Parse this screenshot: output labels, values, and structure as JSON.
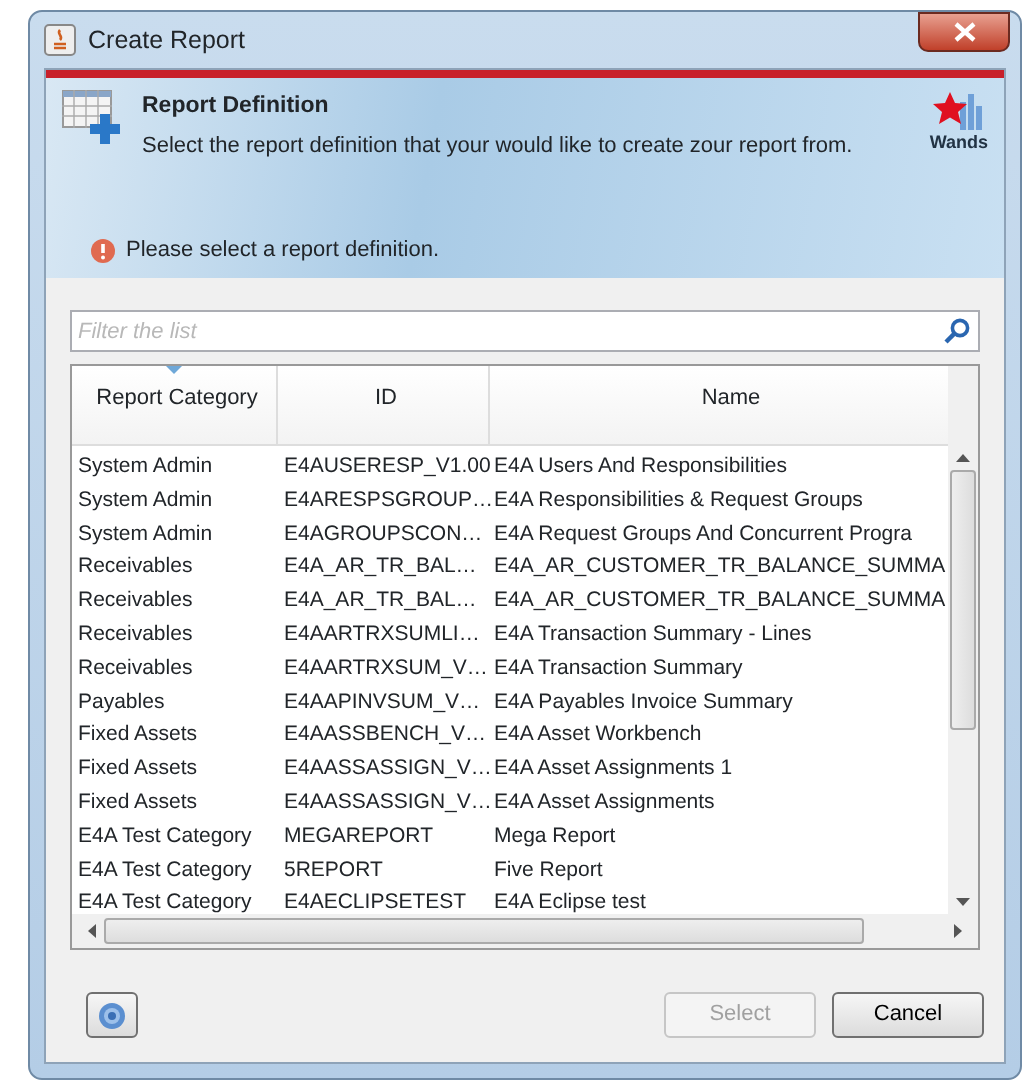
{
  "window": {
    "title": "Create Report"
  },
  "header": {
    "title": "Report Definition",
    "description": "Select the report definition that your would like to create zour report from.",
    "logo_text": "Wands",
    "message": "Please select a report definition."
  },
  "filter": {
    "placeholder": "Filter the list"
  },
  "table": {
    "columns": [
      {
        "label": "Report Category",
        "sorted": true
      },
      {
        "label": "ID",
        "sorted": false
      },
      {
        "label": "Name",
        "sorted": false
      }
    ],
    "rows": [
      [
        "System Admin",
        "E4AUSERESP_V1.00",
        "E4A Users And Responsibilities"
      ],
      [
        "System Admin",
        "E4ARESPSGROUP…",
        "E4A Responsibilities & Request Groups"
      ],
      [
        "System Admin",
        "E4AGROUPSCON…",
        "E4A Request Groups And Concurrent Progra"
      ],
      [
        "Receivables",
        "E4A_AR_TR_BAL…",
        "E4A_AR_CUSTOMER_TR_BALANCE_SUMMA"
      ],
      [
        "Receivables",
        "E4A_AR_TR_BAL…",
        "E4A_AR_CUSTOMER_TR_BALANCE_SUMMA"
      ],
      [
        "Receivables",
        "E4AARTRXSUMLI…",
        "E4A Transaction Summary - Lines"
      ],
      [
        "Receivables",
        "E4AARTRXSUM_V…",
        "E4A Transaction Summary"
      ],
      [
        "Payables",
        "E4AAPINVSUM_V…",
        "E4A Payables Invoice Summary"
      ],
      [
        "Fixed Assets",
        "E4AASSBENCH_V…",
        "E4A Asset Workbench"
      ],
      [
        "Fixed Assets",
        "E4AASSASSIGN_V…",
        "E4A Asset Assignments 1"
      ],
      [
        "Fixed Assets",
        "E4AASSASSIGN_V…",
        "E4A Asset Assignments"
      ],
      [
        "E4A Test Category",
        "MEGAREPORT",
        "Mega Report"
      ],
      [
        "E4A Test Category",
        "5REPORT",
        "Five Report"
      ],
      [
        "E4A Test Category",
        "E4AECLIPSETEST",
        "E4A Eclipse test"
      ]
    ]
  },
  "buttons": [
    {
      "label": "Select",
      "disabled": true
    },
    {
      "label": "Cancel",
      "disabled": false
    }
  ]
}
